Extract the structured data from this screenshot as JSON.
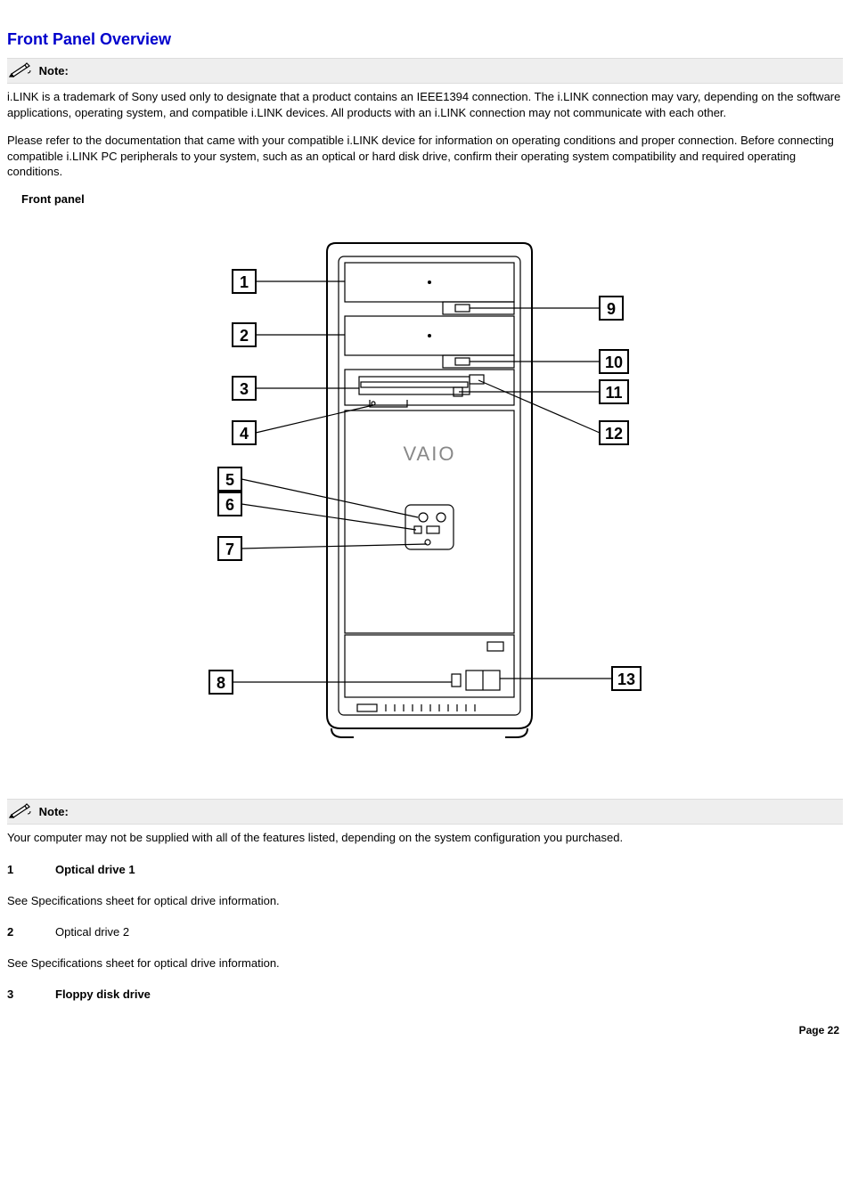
{
  "title": "Front Panel Overview",
  "note_label": "Note:",
  "note1_p1": "i.LINK is a trademark of Sony used only to designate that a product contains an IEEE1394 connection. The i.LINK connection may vary, depending on the software applications, operating system, and compatible i.LINK devices. All products with an i.LINK connection may not communicate with each other.",
  "note1_p2": "Please refer to the documentation that came with your compatible i.LINK device for information on operating conditions and proper connection. Before connecting compatible i.LINK PC peripherals to your system, such as an optical or hard disk drive, confirm their operating system compatibility and required operating conditions.",
  "figure_caption": "Front panel",
  "diagram": {
    "logo_text": "VAIO",
    "callouts": [
      "1",
      "2",
      "3",
      "4",
      "5",
      "6",
      "7",
      "8",
      "9",
      "10",
      "11",
      "12",
      "13"
    ]
  },
  "note2": "Your computer may not be supplied with all of the features listed, depending on the system configuration you purchased.",
  "items": [
    {
      "num": "1",
      "label": "Optical drive 1",
      "bold": true,
      "desc": "See Specifications sheet for optical drive information."
    },
    {
      "num": "2",
      "label": "Optical drive 2",
      "bold": false,
      "desc": "See Specifications sheet for optical drive information."
    },
    {
      "num": "3",
      "label": "Floppy disk drive",
      "bold": true,
      "desc": ""
    }
  ],
  "page_number": "Page 22"
}
